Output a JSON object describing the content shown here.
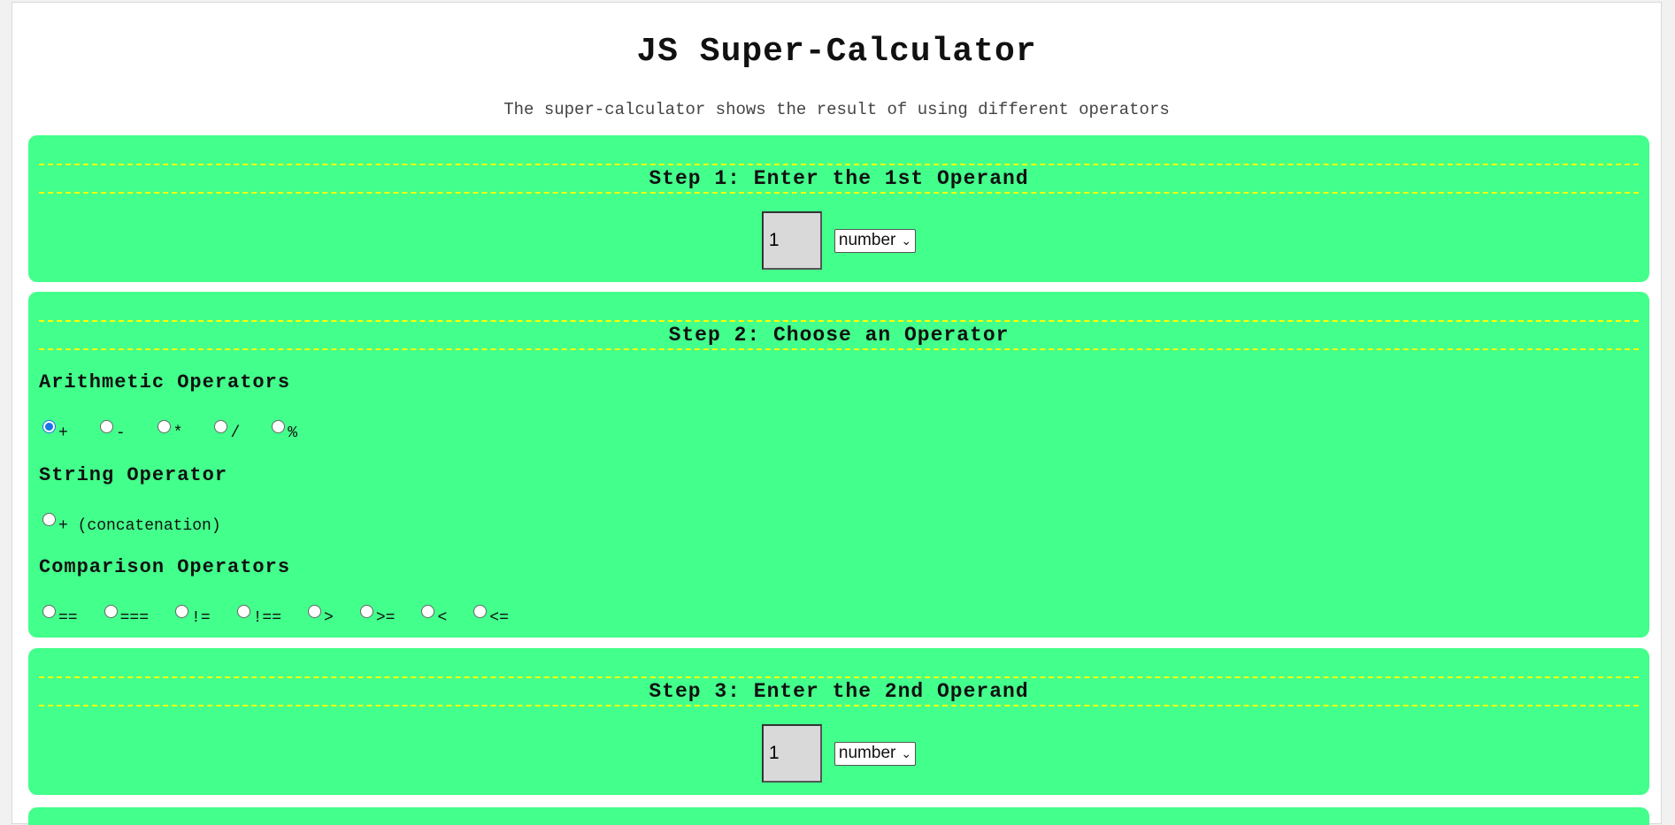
{
  "header": {
    "title": "JS Super-Calculator",
    "subtitle": "The super-calculator shows the result of using different operators"
  },
  "step1": {
    "heading": "Step 1: Enter the 1st Operand",
    "operand_value": "1",
    "type_selected": "number"
  },
  "step2": {
    "heading": "Step 2: Choose an Operator",
    "arithmetic": {
      "label": "Arithmetic Operators",
      "options": [
        "+",
        "-",
        "*",
        "/",
        "%"
      ],
      "selected": "+"
    },
    "string": {
      "label": "String Operator",
      "options": [
        "+ (concatenation)"
      ]
    },
    "comparison": {
      "label": "Comparison Operators",
      "options": [
        "==",
        "===",
        "!=",
        "!==",
        ">",
        ">=",
        "<",
        "<="
      ]
    }
  },
  "step3": {
    "heading": "Step 3: Enter the 2nd Operand",
    "operand_value": "1",
    "type_selected": "number"
  },
  "colors": {
    "panel": "#43ff8b",
    "divider": "#ffff00",
    "radio_selected": "#1a73e8"
  }
}
